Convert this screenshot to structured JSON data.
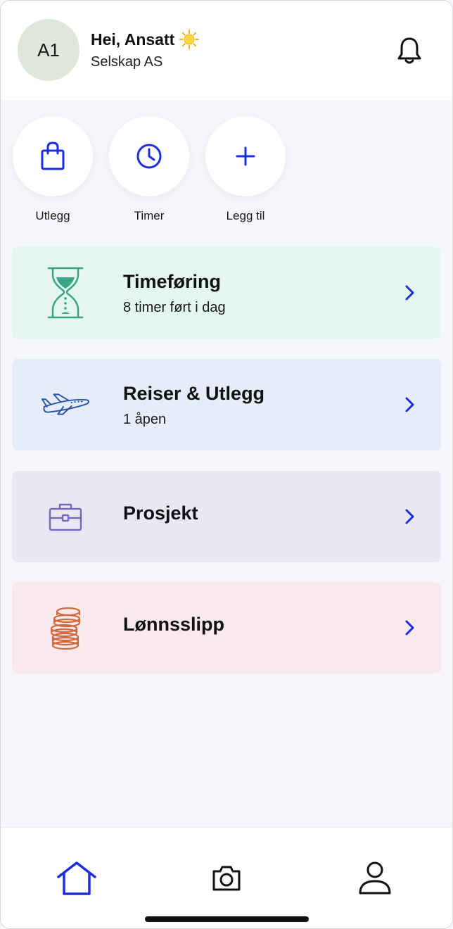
{
  "header": {
    "avatar_initials": "A1",
    "greeting": "Hei, Ansatt",
    "company": "Selskap AS"
  },
  "quick_actions": [
    {
      "label": "Utlegg",
      "icon": "shopping-bag-icon"
    },
    {
      "label": "Timer",
      "icon": "clock-icon"
    },
    {
      "label": "Legg til",
      "icon": "plus-icon"
    }
  ],
  "cards": [
    {
      "title": "Timeføring",
      "subtitle": "8 timer ført i dag",
      "icon": "hourglass-icon",
      "color": "#e3f6ef"
    },
    {
      "title": "Reiser & Utlegg",
      "subtitle": "1 åpen",
      "icon": "airplane-icon",
      "color": "#e6edf8"
    },
    {
      "title": "Prosjekt",
      "subtitle": "",
      "icon": "briefcase-icon",
      "color": "#ebe7f4"
    },
    {
      "title": "Lønnsslipp",
      "subtitle": "",
      "icon": "coins-icon",
      "color": "#f9e8ec"
    }
  ],
  "bottom_nav": [
    {
      "name": "home",
      "icon": "home-icon",
      "active": true
    },
    {
      "name": "camera",
      "icon": "camera-icon",
      "active": false
    },
    {
      "name": "profile",
      "icon": "user-icon",
      "active": false
    }
  ],
  "colors": {
    "accent": "#1a2ee0",
    "background": "#f6f7fb",
    "avatar_bg": "#dfe8d8"
  }
}
